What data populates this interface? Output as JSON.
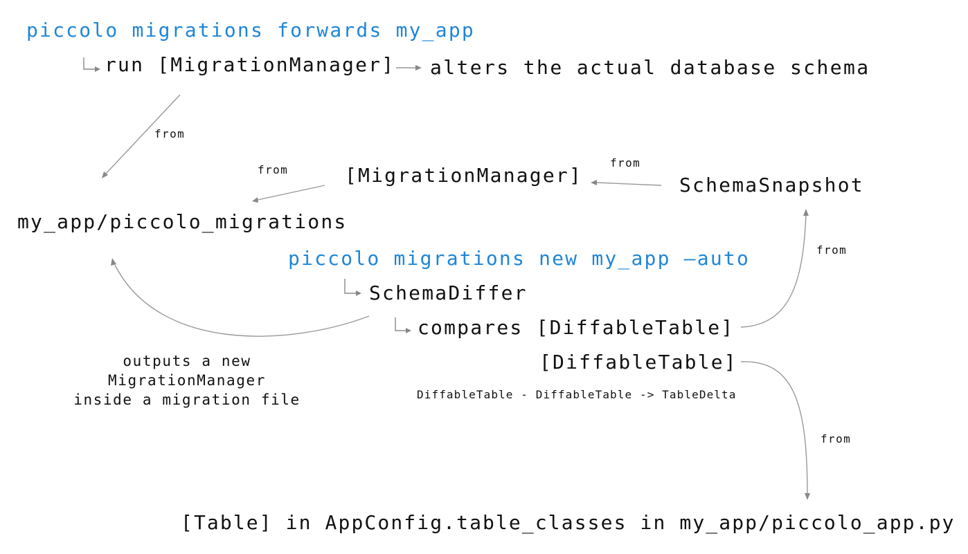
{
  "commands": {
    "forwards": "piccolo migrations forwards my_app",
    "new_auto": "piccolo migrations new my_app —auto"
  },
  "nodes": {
    "run": "run [MigrationManager]",
    "alters": "alters the actual database schema",
    "migration_manager": "[MigrationManager]",
    "schema_snapshot": "SchemaSnapshot",
    "migrations_folder": "my_app/piccolo_migrations",
    "schema_differ": "SchemaDiffer",
    "compares": "compares [DiffableTable]",
    "diffable_table_2": "[DiffableTable]",
    "table_delta": "DiffableTable - DiffableTable -> TableDelta",
    "tables": "[Table] in AppConfig.table_classes in my_app/piccolo_app.py"
  },
  "edge_labels": {
    "from_run": "from",
    "from_manager": "from",
    "from_snapshot": "from",
    "from_compares": "from",
    "from_table": "from"
  },
  "outputs_note": {
    "line1": "outputs a new",
    "line2": "MigrationManager",
    "line3": "inside a migration file"
  },
  "colors": {
    "command": "#1f86d6",
    "text": "#111111",
    "connector": "#999999"
  }
}
